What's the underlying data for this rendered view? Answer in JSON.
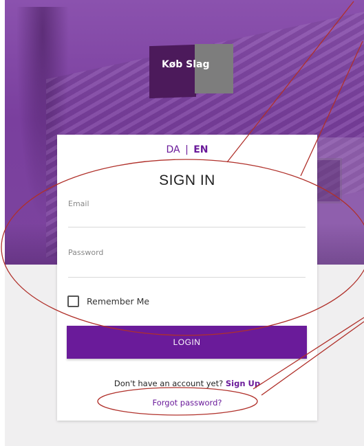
{
  "logo": {
    "text": "Køb Slag"
  },
  "language": {
    "da": "DA",
    "separator": "|",
    "en": "EN",
    "active": "EN"
  },
  "form": {
    "title": "SIGN IN",
    "email_label": "Email",
    "email_value": "",
    "password_label": "Password",
    "password_value": "",
    "remember_label": "Remember Me",
    "remember_checked": false,
    "login_label": "LOGIN"
  },
  "footer": {
    "signup_prompt": "Don't have an account yet?",
    "signup_link": "Sign Up",
    "forgot_link": "Forgot password?"
  },
  "colors": {
    "brand_purple": "#6a1b9a",
    "hero_purple": "#7f46a3",
    "annotation_red": "#b0302a"
  },
  "icons": {
    "checkbox": "checkbox-unchecked-icon"
  }
}
